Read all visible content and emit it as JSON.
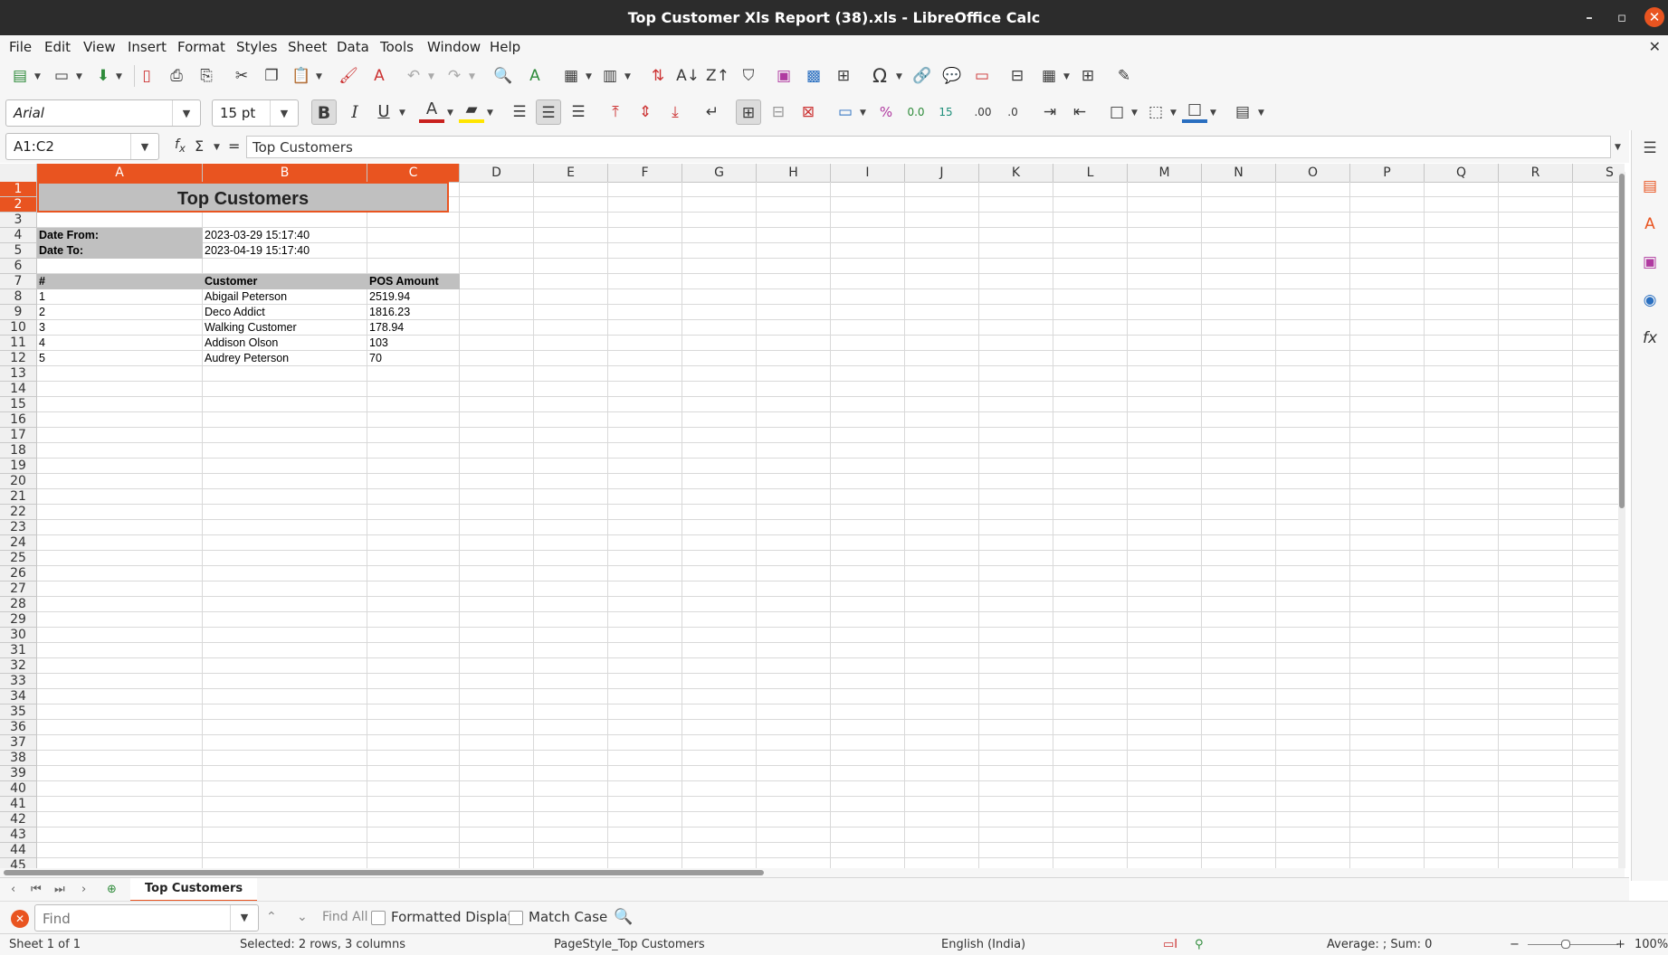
{
  "window": {
    "title": "Top Customer Xls Report (38).xls - LibreOffice Calc",
    "minimize": "–",
    "maximize": "▫",
    "close": "✕"
  },
  "menubar": {
    "items": [
      "File",
      "Edit",
      "View",
      "Insert",
      "Format",
      "Styles",
      "Sheet",
      "Data",
      "Tools",
      "Window",
      "Help"
    ],
    "doc_close": "✕"
  },
  "format_toolbar": {
    "font_name": "Arial",
    "font_size": "15 pt"
  },
  "formula_bar": {
    "name_box": "A1:C2",
    "content": "Top Customers"
  },
  "sheet": {
    "columns": [
      "A",
      "B",
      "C",
      "D",
      "E",
      "F",
      "G",
      "H",
      "I",
      "J",
      "K",
      "L",
      "M",
      "N",
      "O",
      "P",
      "Q",
      "R",
      "S"
    ],
    "rows": [
      "1",
      "2",
      "3",
      "4",
      "5",
      "6",
      "7",
      "8",
      "9",
      "10",
      "11",
      "12",
      "13",
      "14",
      "15",
      "16",
      "17",
      "18",
      "19",
      "20",
      "21",
      "22",
      "23",
      "24",
      "25",
      "26",
      "27",
      "28",
      "29",
      "30",
      "31",
      "32",
      "33",
      "34",
      "35",
      "36",
      "37",
      "38",
      "39",
      "40",
      "41",
      "42",
      "43",
      "44",
      "45"
    ],
    "title": "Top Customers",
    "date_from_label": "Date From:",
    "date_from_value": "2023-03-29 15:17:40",
    "date_to_label": "Date To:",
    "date_to_value": "2023-04-19 15:17:40",
    "table_headers": [
      "#",
      "Customer",
      "POS Amount"
    ],
    "table_rows": [
      [
        "1",
        "Abigail Peterson",
        "2519.94"
      ],
      [
        "2",
        "Deco Addict",
        "1816.23"
      ],
      [
        "3",
        "Walking Customer",
        "178.94"
      ],
      [
        "4",
        "Addison Olson",
        "103"
      ],
      [
        "5",
        "Audrey Peterson",
        "70"
      ]
    ]
  },
  "tabs": {
    "active_sheet": "Top Customers"
  },
  "findbar": {
    "placeholder": "Find",
    "find_all": "Find All",
    "formatted_display": "Formatted Display",
    "match_case": "Match Case"
  },
  "status": {
    "sheet_info": "Sheet 1 of 1",
    "selection": "Selected: 2 rows, 3 columns",
    "page_style": "PageStyle_Top Customers",
    "language": "English (India)",
    "summary": "Average: ; Sum: 0",
    "zoom": "100%"
  },
  "colors": {
    "accent": "#e95420",
    "header_fill": "#c0c0c0"
  }
}
